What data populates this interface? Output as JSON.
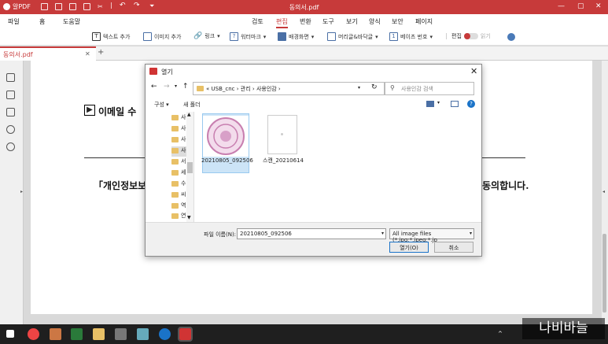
{
  "titlebar": {
    "app_name": "알PDF",
    "document_title": "동의서.pdf"
  },
  "menu": {
    "items": [
      "파일",
      "홈",
      "도움말",
      "검토",
      "편집",
      "변환",
      "도구",
      "보기",
      "양식",
      "보안",
      "페이지"
    ],
    "active": "편집"
  },
  "toolbar": {
    "items": [
      "텍스트 추가",
      "이미지 추가",
      "링크",
      "워터마크",
      "배경화면",
      "머리글&바닥글",
      "베이츠 번호",
      "편집",
      "읽기"
    ]
  },
  "tab": {
    "label": "동의서.pdf"
  },
  "document": {
    "line1": "이메일 수",
    "line2a": "「개인정보보",
    "line2b": "동의합니다."
  },
  "dialog": {
    "title": "열기",
    "address": [
      "«",
      "USB_cnc",
      "관리",
      "사용인감"
    ],
    "search_placeholder": "사용인감 검색",
    "organize": "구성 ▾",
    "new_folder": "새 폴더",
    "nav_items": [
      "사",
      "사",
      "사",
      "사",
      "서",
      "세",
      "수",
      "씨",
      "역",
      "연"
    ],
    "files": [
      {
        "name": "20210805_092506",
        "selected": true
      },
      {
        "name": "스캔_20210614",
        "selected": false
      }
    ],
    "filename_label": "파일 이름(N):",
    "filename_value": "20210805_092506",
    "filetype": "All image files (*.jpg;*.jpeg;*.jp",
    "open_button": "열기(O)",
    "cancel_button": "취소"
  },
  "watermark": "나비바늘",
  "colors": {
    "accent": "#c73a3a",
    "selection": "#cce4f7"
  }
}
